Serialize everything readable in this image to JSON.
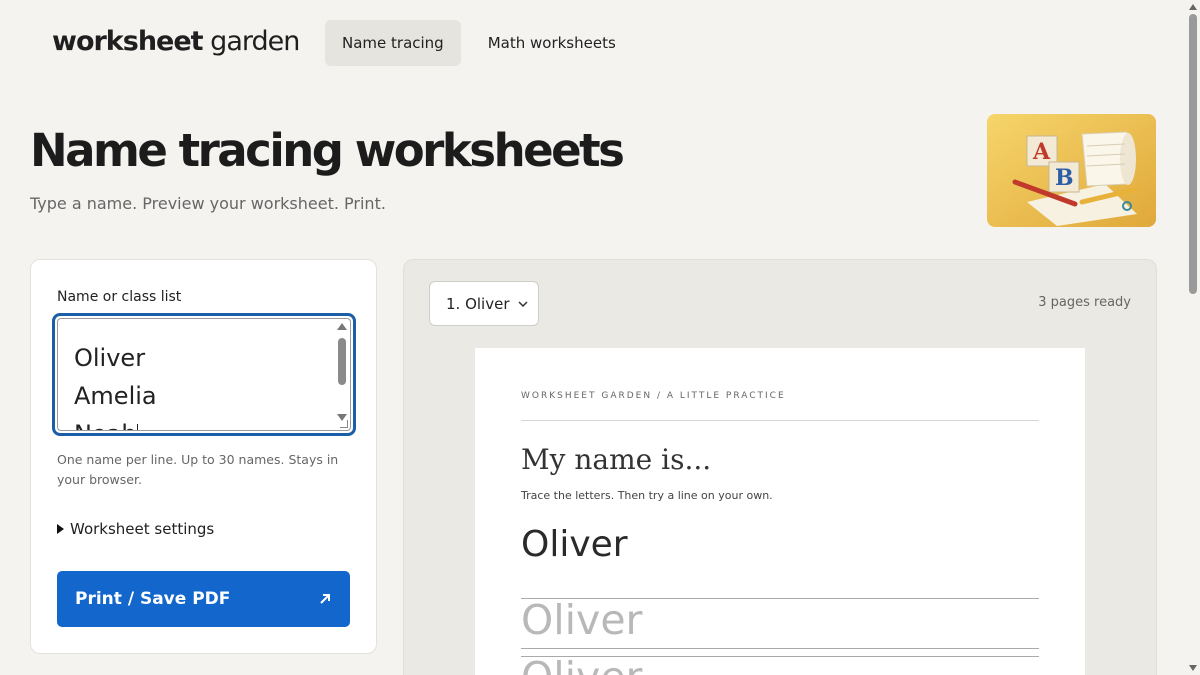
{
  "header": {
    "logo_bold": "worksheet",
    "logo_light": " garden",
    "tabs": [
      {
        "label": "Name tracing",
        "active": true
      },
      {
        "label": "Math worksheets",
        "active": false
      }
    ]
  },
  "page": {
    "title": "Name tracing worksheets",
    "subtitle": "Type a name. Preview your worksheet. Print."
  },
  "hero_image": {
    "description_icon": "abc-blocks-pencil-icon"
  },
  "form": {
    "field_label": "Name or class list",
    "names": [
      "Oliver",
      "Amelia",
      "Noah"
    ],
    "hint": "One name per line. Up to 30 names. Stays in your browser.",
    "settings_label": "Worksheet settings",
    "print_label": "Print / Save PDF",
    "print_icon": "arrow-up-right-icon"
  },
  "preview": {
    "selected_option": "1. Oliver",
    "pages_ready": "3 pages ready",
    "sheet": {
      "header": "WORKSHEET GARDEN / A LITTLE PRACTICE",
      "title": "My name is...",
      "instruction": "Trace the letters. Then try a line on your own.",
      "name": "Oliver",
      "trace_name": "Oliver"
    }
  },
  "colors": {
    "accent": "#1366cc",
    "focus_ring": "#1c5fa8",
    "background": "#f4f3f0"
  }
}
